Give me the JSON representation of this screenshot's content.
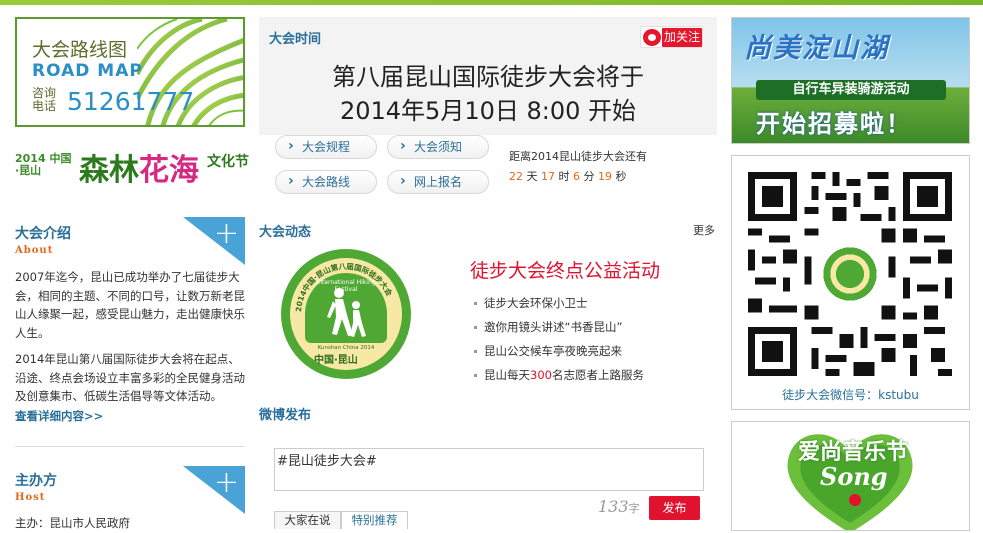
{
  "left": {
    "route_banner": {
      "title": "大会路线图",
      "title_en": "ROAD MAP",
      "phone_label": "咨询电话",
      "phone": "51261777"
    },
    "forest_banner": {
      "year_place": "2014 中国·昆山",
      "name_part1": "森林",
      "name_part2": "花海",
      "suffix": "文化节"
    },
    "intro": {
      "title": "大会介绍",
      "subtitle": "About",
      "para1": "2007年迄今，昆山已成功举办了七届徒步大会，相同的主题、不同的口号，让数万新老昆山人缘聚一起，感受昆山魅力，走出健康快乐人生。",
      "para2": "2014年昆山第八届国际徒步大会将在起点、沿途、终点会场设立丰富多彩的全民健身活动及创意集市、低碳生活倡导等文体活动。",
      "more": "查看详细内容>>"
    },
    "host": {
      "title": "主办方",
      "subtitle": "Host",
      "line1": "主办：昆山市人民政府"
    }
  },
  "center": {
    "time_label": "大会时间",
    "follow_label": "加关注",
    "headline1": "第八届昆山国际徒步大会将于",
    "headline2": "2014年5月10日 8:00 开始",
    "nav": [
      "大会规程",
      "大会须知",
      "大会路线",
      "网上报名"
    ],
    "countdown": {
      "label": "距离2014昆山徒步大会还有",
      "days": "22",
      "days_unit": "天",
      "hours": "17",
      "hours_unit": "时",
      "minutes": "6",
      "minutes_unit": "分",
      "seconds": "19",
      "seconds_unit": "秒"
    },
    "news": {
      "title": "大会动态",
      "more": "更多",
      "logo_arc_text": "2014中国·昆山第八届国际徒步大会",
      "logo_en": "International Hiking Festival",
      "logo_en2": "Kunshan China 2014",
      "logo_foot": "中国·昆山",
      "headline": "徒步大会终点公益活动",
      "items": [
        {
          "text": "徒步大会环保小卫士"
        },
        {
          "text": "邀你用镜头讲述“书香昆山”"
        },
        {
          "text": "昆山公交候车亭夜晚亮起来"
        },
        {
          "pre": "昆山每天",
          "hl": "300",
          "post": "名志愿者上路服务"
        }
      ]
    },
    "weibo": {
      "title": "微博发布",
      "input_value": "#昆山徒步大会#",
      "char_count": "133",
      "char_unit": "字",
      "post_label": "发布",
      "tabs": [
        "大家在说",
        "特别推荐"
      ]
    }
  },
  "right": {
    "banner1": {
      "line1": "尚美淀山湖",
      "line2": "自行车异装骑游活动",
      "line3": "开始招募啦！"
    },
    "qr_label": "徒步大会微信号：kstubu",
    "banner3": {
      "line1": "爱尚音乐节",
      "line2": "Song"
    }
  },
  "colors": {
    "accent_blue": "#2a6f9a",
    "accent_red": "#e0122d",
    "accent_orange": "#e06a1a",
    "green": "#4ea833"
  }
}
